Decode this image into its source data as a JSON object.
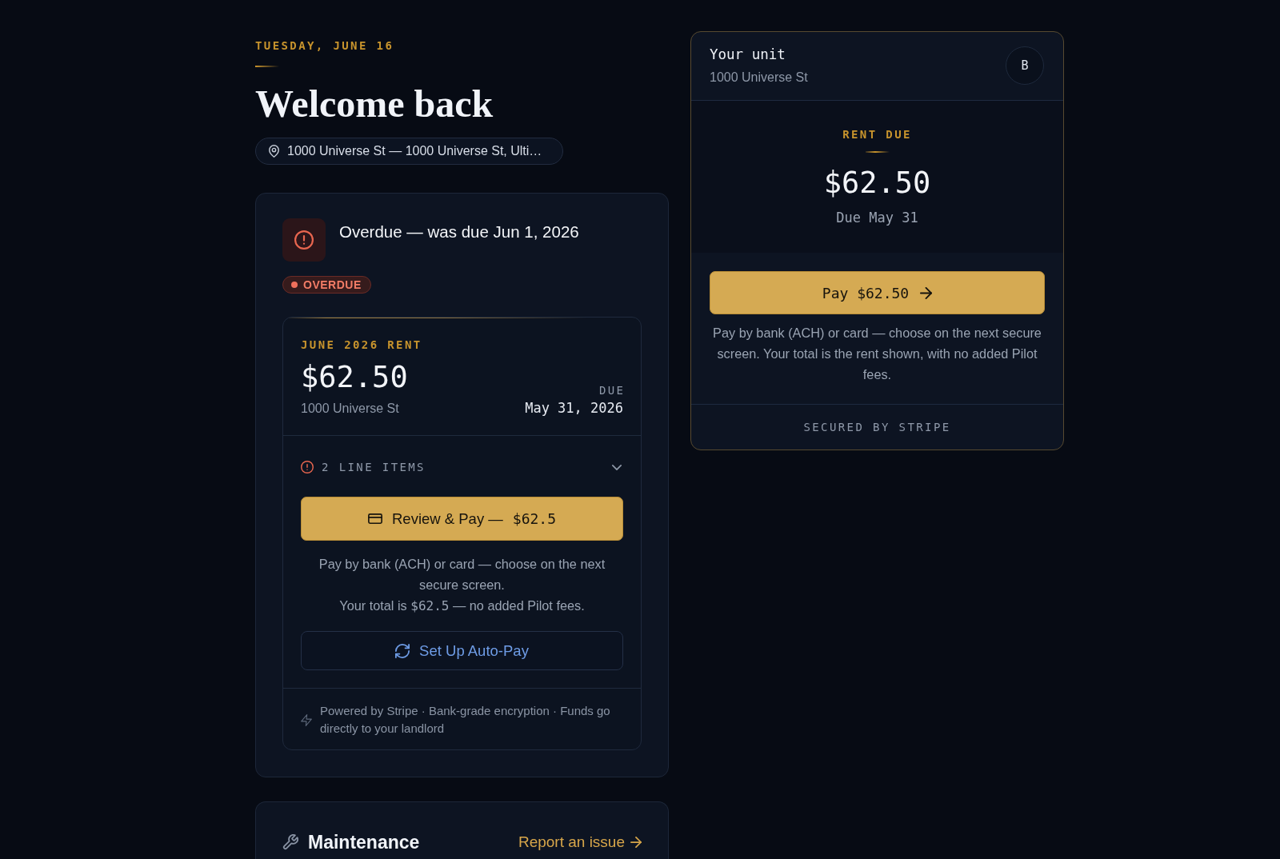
{
  "header": {
    "date": "TUESDAY, JUNE 16",
    "title": "Welcome back",
    "address": "1000 Universe St — 1000 Universe St, Ulti…"
  },
  "rent_card": {
    "overdue": true,
    "title": "Overdue — was due Jun 1, 2026",
    "badge": "OVERDUE",
    "bill": {
      "label": "JUNE 2026 RENT",
      "amount": "$62.50",
      "address": "1000 Universe St",
      "due_label": "DUE",
      "due_date": "May 31, 2026"
    },
    "line_items": {
      "label": "2 LINE ITEMS",
      "expanded": false
    },
    "pay_button": {
      "label": "Review & Pay —",
      "amount": "$62.5"
    },
    "note": {
      "text": "Pay by bank (ACH) or card — choose on the next secure screen.",
      "total_before": "Your total is",
      "total_amount": "$62.5",
      "total_after": "— no added Pilot fees."
    },
    "autopay_button": "Set Up Auto-Pay",
    "footer": "Powered by Stripe · Bank-grade encryption · Funds go directly to your landlord"
  },
  "maintenance": {
    "title": "Maintenance",
    "link": "Report an issue"
  },
  "unit_card": {
    "title": "Your unit",
    "address": "1000 Universe St",
    "avatar": "B",
    "rent_due": {
      "label": "RENT DUE",
      "amount": "$62.50",
      "due": "Due May 31"
    },
    "pay_button": "Pay $62.50",
    "note": "Pay by bank (ACH) or card — choose on the next secure screen. Your total is the rent shown, with no added Pilot fees.",
    "footer": "SECURED BY STRIPE"
  }
}
